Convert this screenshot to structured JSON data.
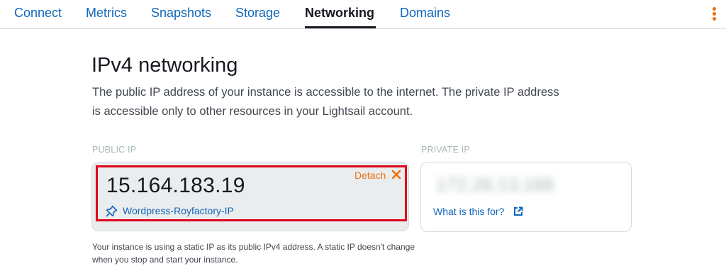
{
  "tabs": [
    {
      "label": "Connect"
    },
    {
      "label": "Metrics"
    },
    {
      "label": "Snapshots"
    },
    {
      "label": "Storage"
    },
    {
      "label": "Networking"
    },
    {
      "label": "Domains"
    }
  ],
  "active_tab": "Networking",
  "menu_icon": "kebab-menu-icon",
  "section": {
    "title": "IPv4 networking",
    "description": "The public IP address of your instance is accessible to the internet. The private IP address is accessible only to other resources in your Lightsail account."
  },
  "public_ip": {
    "label": "PUBLIC IP",
    "address": "15.164.183.19",
    "detach_label": "Detach",
    "static_ip_name": "Wordpress-Royfactory-IP",
    "icon": "pin-icon",
    "note": "Your instance is using a static IP as its public IPv4 address. A static IP doesn't change when you stop and start your instance."
  },
  "private_ip": {
    "label": "PRIVATE IP",
    "address": "172.26.13.168",
    "help_link": "What is this for?",
    "icon": "external-link-icon"
  },
  "colors": {
    "link": "#1166bb",
    "accent": "#ec7211",
    "highlight_border": "#e0001a",
    "card_bg": "#eaeded"
  }
}
